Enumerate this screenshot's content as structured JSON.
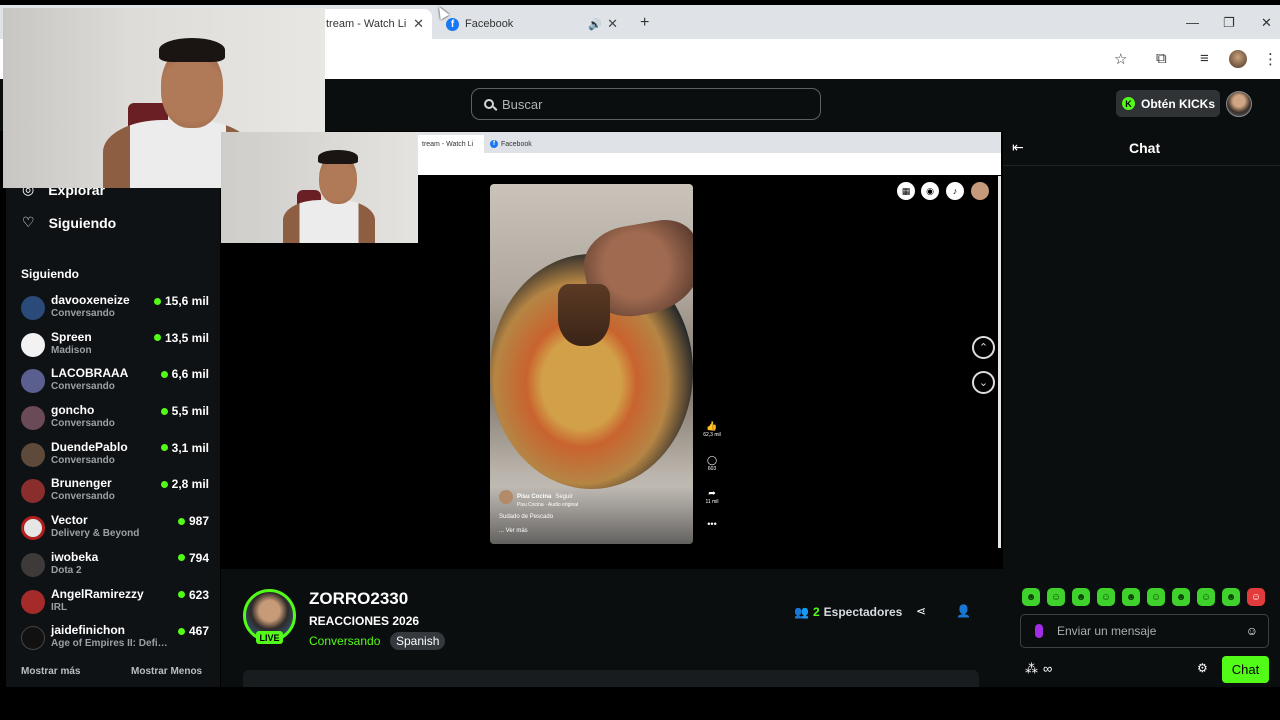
{
  "browser": {
    "tabs": [
      {
        "label": "tream - Watch Li",
        "active": true
      },
      {
        "label": "Facebook",
        "active": false
      }
    ],
    "new_tab_icon": "plus-icon"
  },
  "header": {
    "search_placeholder": "Buscar",
    "kicks_button": "Obtén KICKs",
    "accent": "#53fc18"
  },
  "sidebar": {
    "nav": [
      {
        "label": "Explorar",
        "icon": "compass-icon"
      },
      {
        "label": "Siguiendo",
        "icon": "heart-icon"
      }
    ],
    "section_title": "Siguiendo",
    "following": [
      {
        "name": "davooxeneize",
        "category": "Conversando",
        "viewers": "15,6 mil"
      },
      {
        "name": "Spreen",
        "category": "Madison",
        "viewers": "13,5 mil"
      },
      {
        "name": "LACOBRAAA",
        "category": "Conversando",
        "viewers": "6,6 mil"
      },
      {
        "name": "goncho",
        "category": "Conversando",
        "viewers": "5,5 mil"
      },
      {
        "name": "DuendePablo",
        "category": "Conversando",
        "viewers": "3,1 mil"
      },
      {
        "name": "Brunenger",
        "category": "Conversando",
        "viewers": "2,8 mil"
      },
      {
        "name": "Vector",
        "category": "Delivery & Beyond",
        "viewers": "987"
      },
      {
        "name": "iwobeka",
        "category": "Dota 2",
        "viewers": "794"
      },
      {
        "name": "AngelRamirezzy",
        "category": "IRL",
        "viewers": "623"
      },
      {
        "name": "jaidefinichon",
        "category": "Age of Empires II: Defi…",
        "viewers": "467"
      }
    ],
    "show_more": "Mostrar más",
    "show_less": "Mostrar Menos"
  },
  "player": {
    "inner_tabs": [
      "tream - Watch Li",
      "Facebook"
    ],
    "reel": {
      "author": "Pisu Cocina",
      "follow": "Seguir",
      "audio": "Pisu Cocina · Audio original",
      "caption": "Sudado de Pescado",
      "see_more": "... Ver más",
      "likes": "62,3 mil",
      "comments": "603",
      "shares": "11 mil"
    }
  },
  "stream": {
    "channel": "ZORRO2330",
    "live_label": "LIVE",
    "title": "REACCIONES 2026",
    "category": "Conversando",
    "tag": "Spanish",
    "viewer_count": "2",
    "viewer_label": "Espectadores"
  },
  "chat": {
    "title": "Chat",
    "input_placeholder": "Enviar un mensaje",
    "send_label": "Chat"
  }
}
